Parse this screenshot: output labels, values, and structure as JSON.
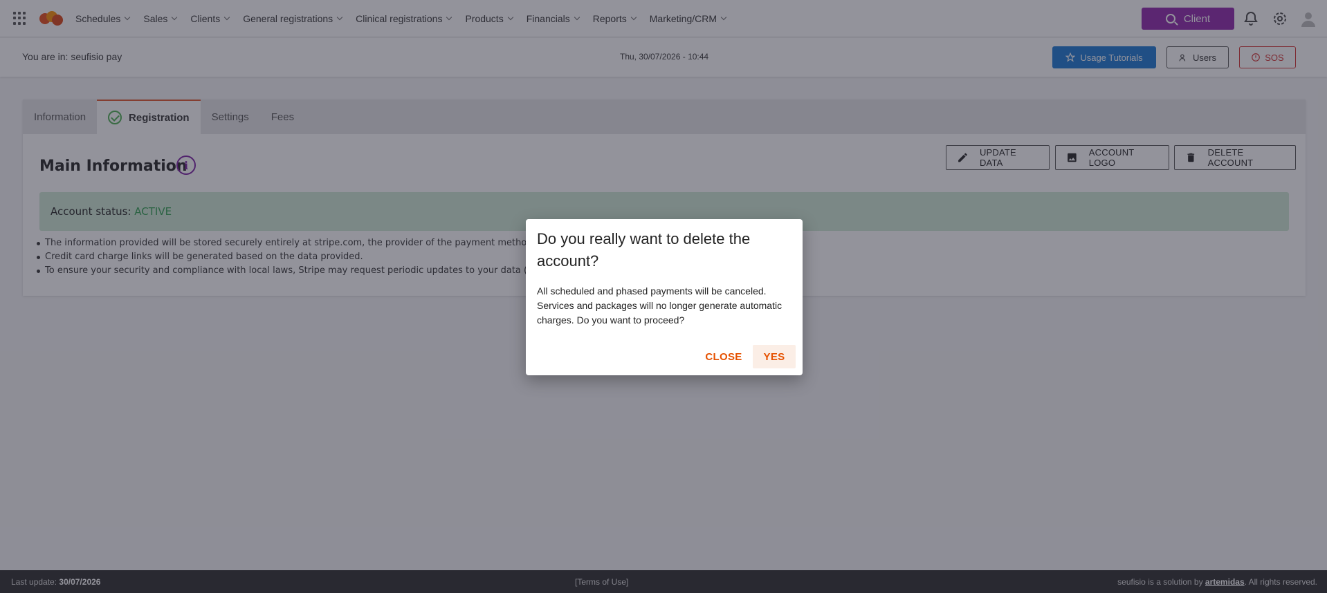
{
  "nav": {
    "items": [
      "Schedules",
      "Sales",
      "Clients",
      "General registrations",
      "Clinical registrations",
      "Products",
      "Financials",
      "Reports",
      "Marketing/CRM"
    ],
    "client_button": "Client"
  },
  "subheader": {
    "location": "You are in: seufisio pay",
    "datetime": "Thu, 30/07/2026 - 10:44",
    "tutorials_button": "Usage Tutorials",
    "users_button": "Users",
    "sos_button": "SOS"
  },
  "tabs": [
    "Information",
    "Registration",
    "Settings",
    "Fees"
  ],
  "active_tab": "Registration",
  "main": {
    "title": "Main Information",
    "info_icon_label": "i",
    "buttons": {
      "update": "UPDATE DATA",
      "logo": "ACCOUNT LOGO",
      "delete": "DELETE ACCOUNT"
    },
    "status_label": "Account status:",
    "status_value": "ACTIVE",
    "bullets": [
      "The information provided will be stored securely entirely at stripe.com, the provider of the payment methods a",
      "Credit card charge links will be generated based on the data provided.",
      "To ensure your security and compliance with local laws, Stripe may request periodic updates to your data (Not"
    ]
  },
  "dialog": {
    "title": "Do you really want to delete the account?",
    "body": "All scheduled and phased payments will be canceled. Services and packages will no longer generate automatic charges. Do you want to proceed?",
    "close": "CLOSE",
    "yes": "YES"
  },
  "footer": {
    "last_update_label": "Last update:",
    "last_update_value": "30/07/2026",
    "terms": "[Terms of Use]",
    "credit_prefix": "seufisio is a solution by",
    "credit_link": "artemidas",
    "credit_suffix": ". All rights reserved."
  },
  "colors": {
    "accent_purple": "#8e24aa",
    "primary_blue": "#1976d2",
    "danger_red": "#d32f2f",
    "status_green": "#2e9e4e",
    "dialog_action": "#e65100"
  }
}
